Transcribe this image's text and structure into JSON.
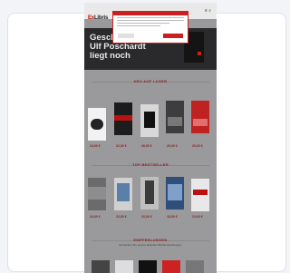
{
  "site": {
    "logo_top": "Ex",
    "logo_bottom": "Libris",
    "header_icons": "≡ ⌕"
  },
  "hero": {
    "line1": "Geschenk",
    "line2": "Ulf Poschardt",
    "line3": "liegt noch"
  },
  "sections": [
    {
      "title": "NEU AUF LAGER"
    },
    {
      "title": "TOP BESTSELLER"
    },
    {
      "title": "EMPFEHLUNGEN",
      "subtitle": "Entdecken Sie unsere aktuellen Buchempfehlungen"
    }
  ],
  "prices": [
    "24,00 €",
    "22,00 €",
    "26,00 €",
    "25,00 €",
    "20,00 €",
    "24,00 €",
    "22,00 €",
    "20,00 €",
    "18,00 €",
    "24,00 €"
  ],
  "colors": {
    "overlay": "#9a9a9c",
    "accent": "#cc2020",
    "hero_bg": "#2a2a2c"
  }
}
